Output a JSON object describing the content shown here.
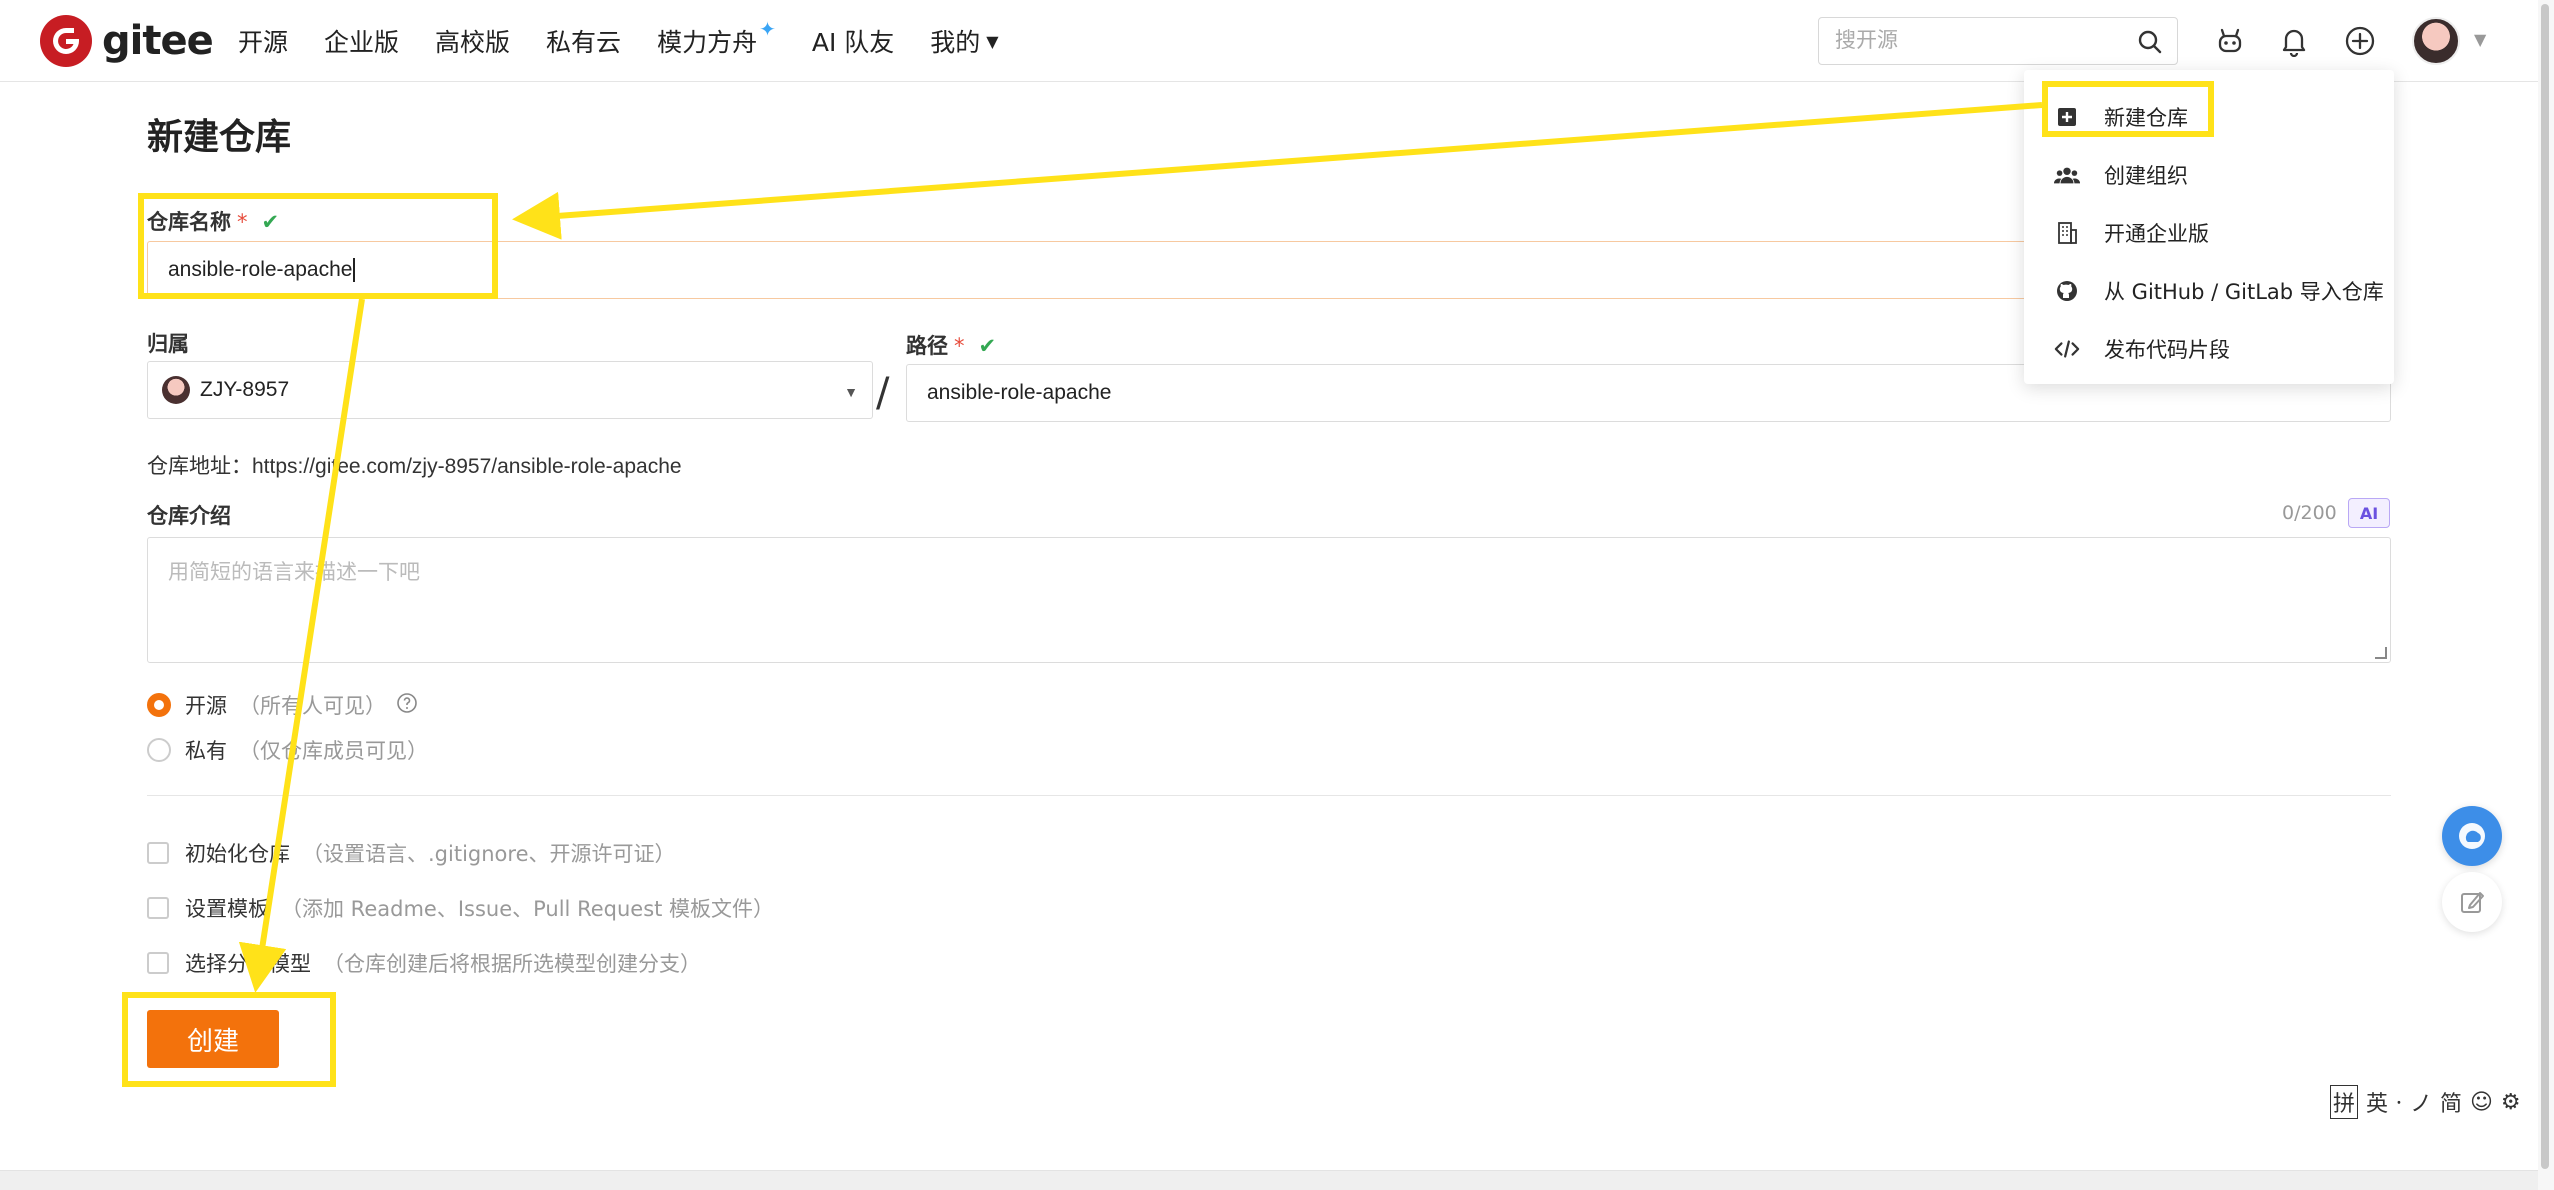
{
  "brand": {
    "name": "gitee",
    "color": "#c71d23"
  },
  "nav": {
    "items": [
      {
        "label": "开源"
      },
      {
        "label": "企业版"
      },
      {
        "label": "高校版"
      },
      {
        "label": "私有云"
      },
      {
        "label": "模力方舟"
      },
      {
        "label": "AI 队友"
      },
      {
        "label": "我的"
      }
    ]
  },
  "search": {
    "placeholder": "搜开源"
  },
  "header_icons": [
    "search-icon",
    "bot-icon",
    "bell-icon",
    "plus-circle-icon"
  ],
  "form": {
    "title": "新建仓库",
    "repo_name": {
      "label": "仓库名称",
      "value": "ansible-role-apache"
    },
    "owner": {
      "label": "归属",
      "value": "ZJY-8957"
    },
    "path": {
      "label": "路径",
      "value": "ansible-role-apache"
    },
    "repo_url": {
      "prefix": "仓库地址：",
      "value": "https://gitee.com/zjy-8957/ansible-role-apache"
    },
    "description": {
      "label": "仓库介绍",
      "placeholder": "用简短的语言来描述一下吧",
      "counter": "0/200",
      "ai_label": "AI"
    },
    "visibility": [
      {
        "label": "开源",
        "hint": "（所有人可见）",
        "selected": true
      },
      {
        "label": "私有",
        "hint": "（仅仓库成员可见）",
        "selected": false
      }
    ],
    "options": [
      {
        "label": "初始化仓库",
        "hint": "（设置语言、.gitignore、开源许可证）"
      },
      {
        "label": "设置模板",
        "hint": "（添加 Readme、Issue、Pull Request 模板文件）"
      },
      {
        "label": "选择分支模型",
        "hint": "（仓库创建后将根据所选模型创建分支）"
      }
    ],
    "submit_label": "创建"
  },
  "dropdown": {
    "items": [
      {
        "label": "新建仓库",
        "icon": "plus-square-icon"
      },
      {
        "label": "创建组织",
        "icon": "users-icon"
      },
      {
        "label": "开通企业版",
        "icon": "building-icon"
      },
      {
        "label": "从 GitHub / GitLab 导入仓库",
        "icon": "github-icon"
      },
      {
        "label": "发布代码片段",
        "icon": "code-icon"
      }
    ]
  },
  "ime_toolbar": {
    "items": [
      "拼",
      "英",
      "⸱",
      "ノ",
      "简",
      "☺",
      "⚙"
    ]
  },
  "colors": {
    "accent": "#f3720c",
    "annotation": "#ffe219",
    "check": "#34a853"
  }
}
